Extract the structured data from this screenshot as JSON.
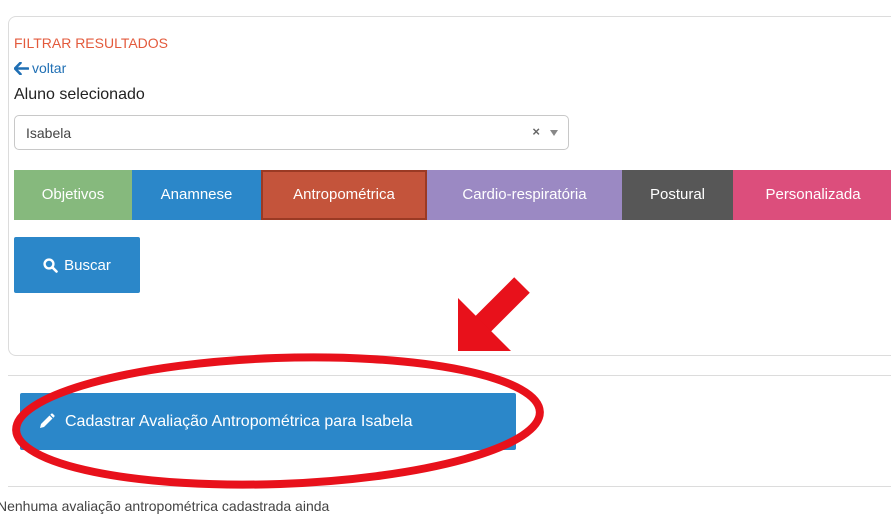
{
  "filter": {
    "title": "FILTRAR RESULTADOS",
    "back_link": "voltar",
    "student_label": "Aluno selecionado",
    "student_select": {
      "selected_value": "Isabela",
      "clear_symbol": "×"
    },
    "tabs": [
      {
        "label": "Objetivos",
        "color": "#86b97d"
      },
      {
        "label": "Anamnese",
        "color": "#2b87c9"
      },
      {
        "label": "Antropométrica",
        "color": "#c4543b",
        "active": true
      },
      {
        "label": "Cardio-respiratória",
        "color": "#9b89c3"
      },
      {
        "label": "Postural",
        "color": "#575757"
      },
      {
        "label": "Personalizada",
        "color": "#dc4e7c"
      }
    ],
    "search_button": {
      "label": "Buscar",
      "icon": "search-icon"
    }
  },
  "register": {
    "button_label": "Cadastrar Avaliação Antropométrica para Isabela",
    "icon": "pencil-icon"
  },
  "empty_message": "Nenhuma avaliação antropométrica cadastrada ainda",
  "annotation": {
    "color": "#e8111b",
    "arrow_icon": "arrow-icon",
    "highlight": "ellipse"
  },
  "colors": {
    "accent_blue": "#2b87c9",
    "filter_title": "#e35a3c",
    "link_blue": "#1f6fb4"
  }
}
